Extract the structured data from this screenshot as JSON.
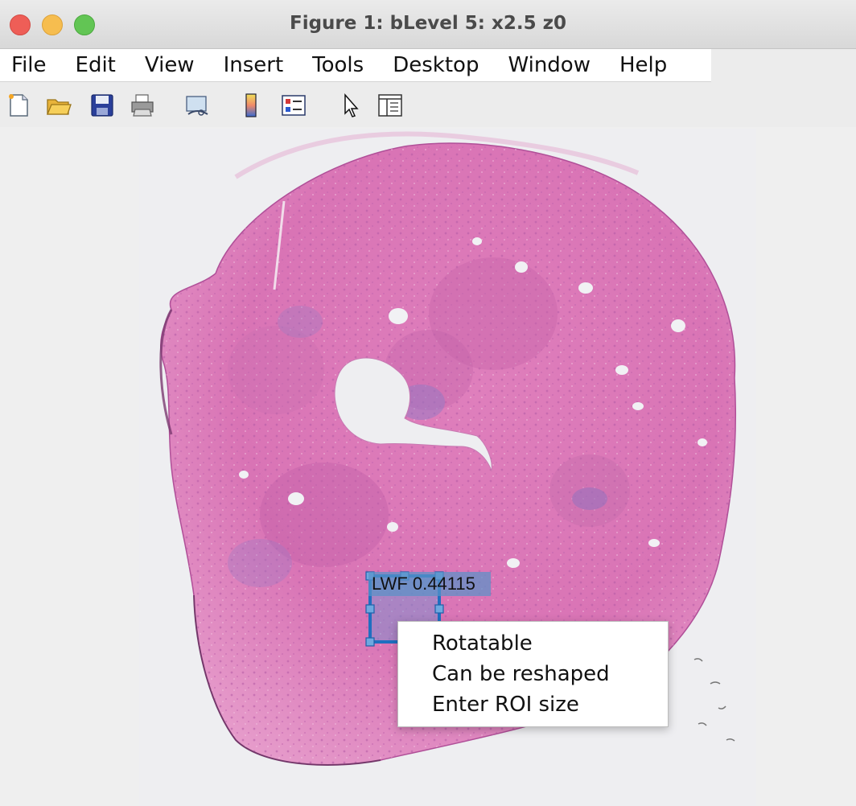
{
  "window": {
    "title": "Figure 1: bLevel 5: x2.5 z0"
  },
  "menubar": {
    "items": [
      {
        "label": "File"
      },
      {
        "label": "Edit"
      },
      {
        "label": "View"
      },
      {
        "label": "Insert"
      },
      {
        "label": "Tools"
      },
      {
        "label": "Desktop"
      },
      {
        "label": "Window"
      },
      {
        "label": "Help"
      }
    ]
  },
  "toolbar": {
    "icons": [
      "new-figure-icon",
      "open-file-icon",
      "save-icon",
      "print-icon",
      "link-plot-icon",
      "colorbar-icon",
      "legend-icon",
      "edit-plot-cursor-icon",
      "property-inspector-icon"
    ]
  },
  "roi": {
    "label": "LWF 0.44115",
    "color": "#1f6fc0"
  },
  "context_menu": {
    "items": [
      {
        "label": "Rotatable"
      },
      {
        "label": "Can be reshaped"
      },
      {
        "label": "Enter ROI size"
      }
    ]
  },
  "colors": {
    "tissue": "#e07ab7",
    "tissue_dark": "#b95aa5",
    "background": "#eeeef1"
  }
}
